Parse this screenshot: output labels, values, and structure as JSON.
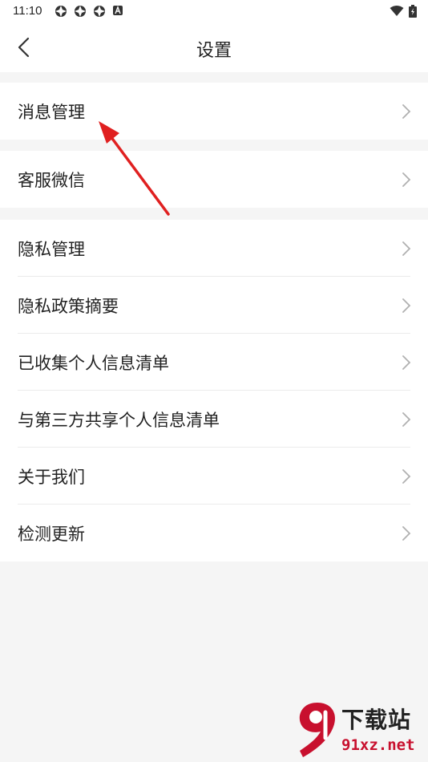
{
  "status_bar": {
    "time": "11:10",
    "notification_icons": [
      "app-icon",
      "app-icon",
      "app-icon",
      "a-icon"
    ],
    "right_icons": [
      "wifi-icon",
      "battery-icon"
    ]
  },
  "header": {
    "title": "设置",
    "back_icon": "chevron-left-icon"
  },
  "groups": [
    {
      "items": [
        {
          "label": "消息管理"
        }
      ]
    },
    {
      "items": [
        {
          "label": "客服微信"
        }
      ]
    },
    {
      "items": [
        {
          "label": "隐私管理"
        },
        {
          "label": "隐私政策摘要"
        },
        {
          "label": "已收集个人信息清单"
        },
        {
          "label": "与第三方共享个人信息清单"
        },
        {
          "label": "关于我们"
        },
        {
          "label": "检测更新"
        }
      ]
    }
  ],
  "annotation": {
    "color": "#e02020"
  },
  "watermark": {
    "top": "下载站",
    "bottom": "91xz.net",
    "accent": "#c8102e"
  }
}
